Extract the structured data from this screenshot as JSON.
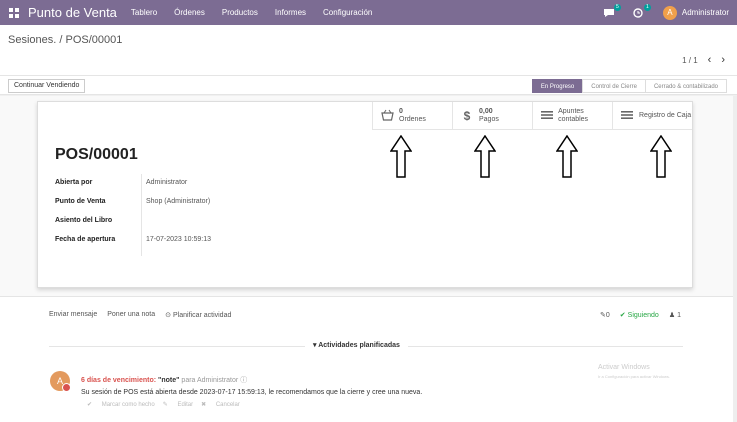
{
  "navbar": {
    "brand": "Punto de Venta",
    "menu": [
      "Tablero",
      "Órdenes",
      "Productos",
      "Informes",
      "Configuración"
    ],
    "chat_badge": "5",
    "activity_badge": "1",
    "user_initial": "A",
    "user_name": "Administrator"
  },
  "breadcrumb": "Sesiones. / POS/00001",
  "pager": {
    "value": "1 / 1",
    "prev": "‹",
    "next": "›"
  },
  "statusbar": {
    "continue_label": "Continuar Vendiendo",
    "stages": [
      "En Progreso",
      "Control de Cierre",
      "Cerrado & contabilizado"
    ],
    "active_stage": "En Progreso"
  },
  "stat_buttons": [
    {
      "value": "0",
      "label": "Ordenes",
      "icon": "basket-icon"
    },
    {
      "value": "0,00",
      "label": "Pagos",
      "icon": "dollar-icon"
    },
    {
      "value": "",
      "label": "Apuntes contables",
      "icon": "list-icon"
    },
    {
      "value": "",
      "label": "Registro de Caja",
      "icon": "list-icon"
    }
  ],
  "record": {
    "title": "POS/00001",
    "fields": [
      {
        "label": "Abierta por",
        "value": "Administrator"
      },
      {
        "label": "Punto de Venta",
        "value": "Shop (Administrator)"
      },
      {
        "label": "Asiento del Libro",
        "value": ""
      },
      {
        "label": "Fecha de apertura",
        "value": "17-07-2023 10:59:13"
      }
    ]
  },
  "chatter": {
    "send_message": "Enviar mensaje",
    "log_note": "Poner una nota",
    "schedule": "Planificar actividad",
    "attachments": "0",
    "following": "Siguiendo",
    "followers": "1",
    "activities_title": "Actividades planificadas",
    "activity": {
      "avatar_initial": "A",
      "due": "6 días de vencimiento:",
      "note": "\"note\"",
      "for": "para Administrator",
      "body": "Su sesión de POS está abierta desde 2023-07-17 15:59:13, le recomendamos que la cierre y cree una nueva.",
      "mark_done": "Marcar como hecho",
      "edit": "Editar",
      "cancel": "Cancelar"
    }
  },
  "watermark": {
    "title": "Activar Windows",
    "subtitle": "Ir a Configuración para activar Windows."
  }
}
